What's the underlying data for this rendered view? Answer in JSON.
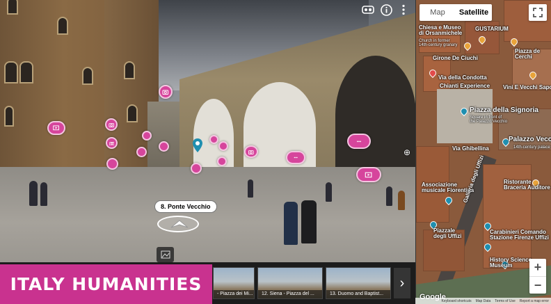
{
  "panorama": {
    "nav_label": "8. Ponte Vecchio",
    "icons": [
      "vr-icon",
      "info-icon",
      "more-vert-icon",
      "image-icon"
    ]
  },
  "banner": {
    "title": "ITALY HUMANITIES",
    "color": "#c9328f"
  },
  "filmstrip": {
    "items": [
      {
        "caption": "- Piazza dei Mi..."
      },
      {
        "caption": "12. Siena - Piazza del ..."
      },
      {
        "caption": "13. Duomo and Baptist..."
      }
    ],
    "next_label": "›"
  },
  "map": {
    "toggle": {
      "map": "Map",
      "satellite": "Satellite",
      "active": "Satellite"
    },
    "labels": {
      "chiesa": "Chiesa e Museo\ndi Orsanmichele",
      "chiesa_sub": "Church in former\n14th-century granary",
      "gustarium": "GUSTARIUM",
      "girone": "Girone De Ciuchi",
      "condotta": "Via della Condotta",
      "chianti": "Chianti Experience",
      "piazza_cerchi": "Piazza de\nCerchi",
      "vini": "Vini E Vecchi Sapori",
      "signoria": "Piazza della Signoria",
      "signoria_sub": "Square in front of\nthe Palazzo Vecchio",
      "palazzo": "Palazzo Vecchio",
      "palazzo_sub": "14th-century palace",
      "via_ghibellina": "Via Ghibellina",
      "assoc": "Associazione\nmusicale Fiorentina",
      "ristorante": "Ristorante\nBraceria Auditore",
      "galleria": "Galleria degli Uffizi",
      "piazzale": "Piazzale\ndegli Uffizi",
      "carabinieri": "Carabinieri Comando\nStazione Firenze Uffizi",
      "history": "History Science\nMuseum"
    },
    "attribution": [
      "Keyboard shortcuts",
      "Map Data",
      "Terms of Use",
      "Report a map error"
    ],
    "google": "Google",
    "zoom": {
      "in": "+",
      "out": "−"
    }
  }
}
